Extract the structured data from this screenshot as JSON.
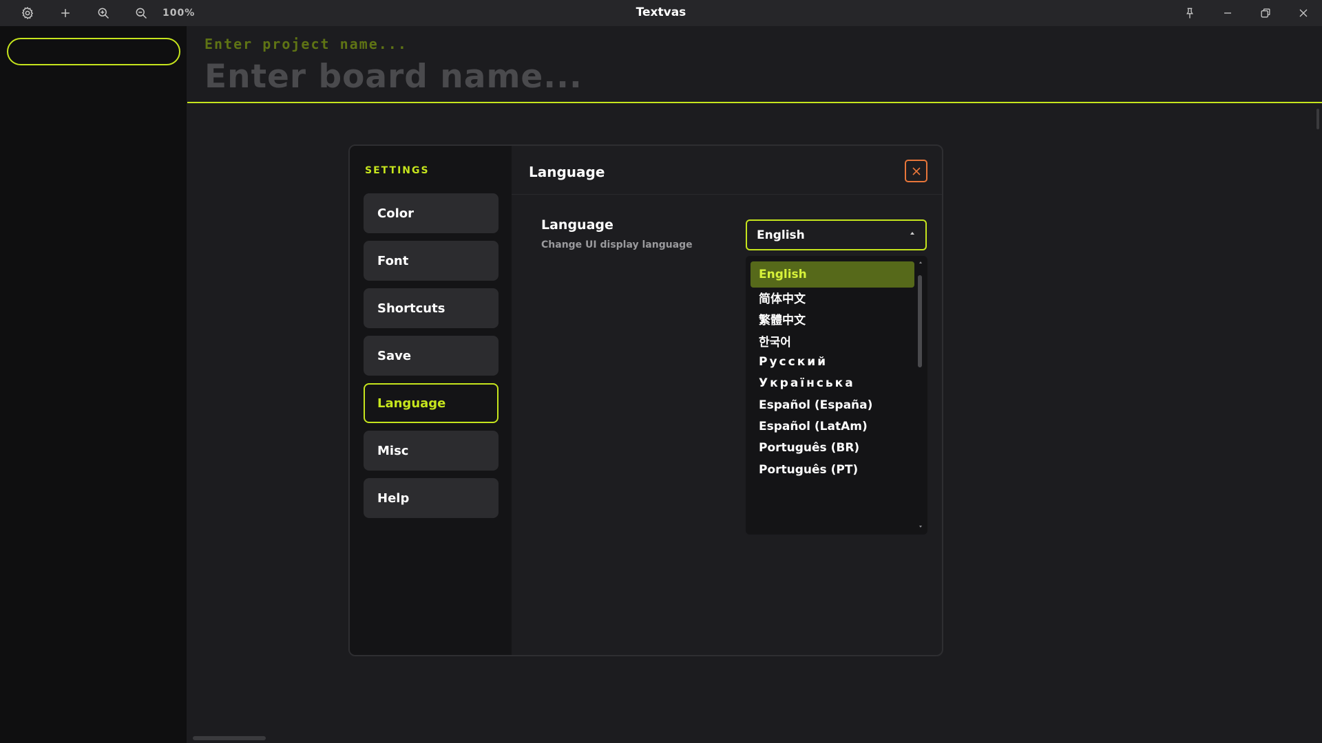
{
  "titlebar": {
    "title": "Textvas",
    "zoom": "100%",
    "left_icons": [
      "gear-icon",
      "plus-icon",
      "zoom-in-icon",
      "zoom-out-icon"
    ],
    "right_icons": [
      "pin-icon",
      "minimize-icon",
      "restore-icon",
      "close-icon"
    ]
  },
  "sidebar": {
    "search_value": ""
  },
  "header": {
    "project_placeholder": "Enter project name...",
    "board_placeholder": "Enter board name..."
  },
  "settings": {
    "heading": "SETTINGS",
    "nav": [
      {
        "label": "Color"
      },
      {
        "label": "Font"
      },
      {
        "label": "Shortcuts"
      },
      {
        "label": "Save"
      },
      {
        "label": "Language",
        "active": true
      },
      {
        "label": "Misc"
      },
      {
        "label": "Help"
      }
    ],
    "panel_title": "Language",
    "setting": {
      "label": "Language",
      "description": "Change UI display language",
      "selected": "English"
    },
    "language_options": [
      "English",
      "简体中文",
      "繁體中文",
      "한국어",
      "Русский",
      "Українська",
      "Español (España)",
      "Español (LatAm)",
      "Português (BR)",
      "Português (PT)"
    ]
  },
  "colors": {
    "accent": "#c6e51d",
    "close_accent": "#e8763a",
    "selected_option_bg": "#56691a"
  }
}
